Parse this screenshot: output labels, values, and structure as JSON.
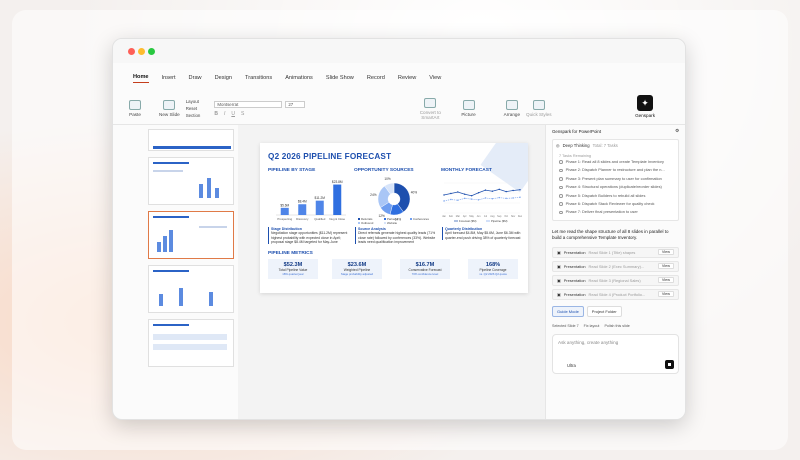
{
  "menu": {
    "tabs": [
      "Home",
      "Insert",
      "Draw",
      "Design",
      "Transitions",
      "Animations",
      "Slide Show",
      "Record",
      "Review",
      "View"
    ]
  },
  "ribbon": {
    "paste": "Paste",
    "new_slide": "New Slide",
    "layout": "Layout",
    "reset": "Reset",
    "section": "Section",
    "font_name": "Montserrat",
    "font_size": "27",
    "convert": "Convert to SmartArt",
    "picture": "Picture",
    "arrange": "Arrange",
    "quick_styles": "Quick Styles",
    "genspark": "Genspark"
  },
  "slide": {
    "title": "Q2 2026 PIPELINE FORECAST",
    "stage_heading": "PIPELINE BY STAGE",
    "source_heading": "OPPORTUNITY SOURCES",
    "monthly_heading": "MONTHLY FORECAST",
    "metrics_heading": "PIPELINE METRICS",
    "captions": [
      {
        "title": "Stage Distribution",
        "text": "Negotiation stage opportunities ($11.2M) represent highest probability with expected close in April; proposal stage $8.4M targeted for May-June"
      },
      {
        "title": "Source Analysis",
        "text": "Direct referrals generate highest quality leads (71% close rate) followed by conferences (33%). Website leads need qualification improvement"
      },
      {
        "title": "Quarterly Distribution",
        "text": "April forecast $4.8M, May $5.6M, June $6.3M with quarter-end push driving 38% of quarterly forecast"
      }
    ],
    "metrics": [
      {
        "value": "$52.3M",
        "label": "Total Pipeline Value",
        "sub": "18% quarter/year"
      },
      {
        "value": "$23.6M",
        "label": "Weighted Pipeline",
        "sub": "Stage probability adjusted"
      },
      {
        "value": "$16.7M",
        "label": "Conservative Forecast",
        "sub": "70% confidence level"
      },
      {
        "value": "168%",
        "label": "Pipeline Coverage",
        "sub": "vs. Q2 2026 Q2 quota"
      }
    ]
  },
  "chart_data": [
    {
      "type": "bar",
      "title": "PIPELINE BY STAGE",
      "categories": [
        "Prospecting",
        "Discovery",
        "Qualified",
        "Neg & Close"
      ],
      "values": [
        5.6,
        8.4,
        11.2,
        23.8
      ],
      "data_labels": [
        "$5.6M",
        "$8.4M",
        "$11.2M",
        "$23.8M"
      ],
      "ylim": [
        0,
        25
      ]
    },
    {
      "type": "pie",
      "title": "OPPORTUNITY SOURCES",
      "categories": [
        "Referrals",
        "Partners",
        "Conferences",
        "Outbound",
        "Website"
      ],
      "values": [
        40,
        14,
        12,
        24,
        10
      ],
      "data_labels": [
        "40%",
        "14%",
        "12%",
        "24%",
        "10%"
      ],
      "colors": [
        "#1d4fae",
        "#2f6fe0",
        "#6f9ef0",
        "#a9c6f6",
        "#d7e4fa"
      ]
    },
    {
      "type": "line",
      "title": "MONTHLY FORECAST",
      "x": [
        "Jan",
        "Feb",
        "Mar",
        "Apr",
        "May",
        "Jun",
        "Jul",
        "Aug",
        "Sep",
        "Oct",
        "Nov",
        "Dec"
      ],
      "series": [
        {
          "name": "Forecast ($M)",
          "values": [
            4.8,
            5.2,
            5.6,
            5.0,
            4.6,
            5.4,
            6.1,
            5.8,
            6.3,
            5.7,
            6.0,
            6.2
          ]
        },
        {
          "name": "Pipeline ($M)",
          "values": [
            3.2,
            3.6,
            3.4,
            3.9,
            3.7,
            3.5,
            4.0,
            3.8,
            4.1,
            3.9,
            4.0,
            4.2
          ]
        }
      ]
    }
  ],
  "panel": {
    "title": "Genspark for PowerPoint",
    "deep_thinking": "Deep Thinking",
    "total_tasks": "Total: 7 Tasks",
    "tasks_remaining": "7 Tasks Remaining",
    "tasks": [
      "Phase 1: Read all 8 slides and create Template Inventory",
      "Phase 2: Dispatch Planner to restructure and plan the n...",
      "Phase 3: Present plan summary to user for confirmation",
      "Phase 4: Structural operations (duplicate/reorder slides)",
      "Phase 5: Dispatch Builders to rebuild all slides",
      "Phase 6: Dispatch Stack Reviewer for quality check",
      "Phase 7: Deliver final presentation to user"
    ],
    "message": "Let me read the shape structure of all 8 slides in parallel to build a comprehensive Template Inventory.",
    "presentations": [
      {
        "label": "Presentation",
        "detail": "Read Slide 1 (Title) shapes"
      },
      {
        "label": "Presentation",
        "detail": "Read Slide 2 (Exec Summary)..."
      },
      {
        "label": "Presentation",
        "detail": "Read Slide 3 (Regional Sales)"
      },
      {
        "label": "Presentation",
        "detail": "Read Slide 4 (Product Portfolio..."
      }
    ],
    "view_label": "View",
    "guide_mode": "Guide Mode",
    "project_folder": "Project Folder",
    "selected_slide": "Selected Slide 7",
    "fix_layout": "Fix layout",
    "polish": "Polish this slide",
    "input_placeholder": "Ask anything, create anything",
    "model": "Ultra"
  }
}
